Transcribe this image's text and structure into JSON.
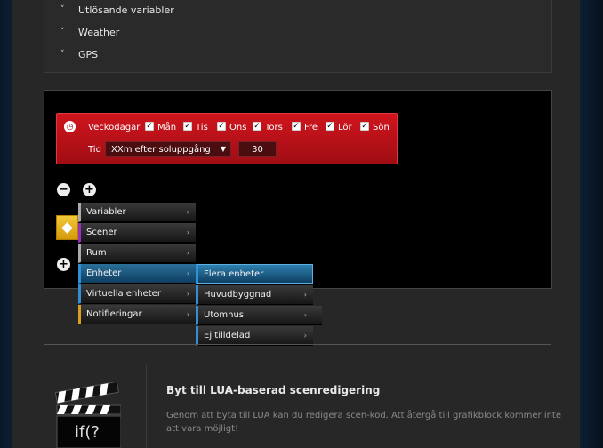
{
  "collapse_list": {
    "items": [
      {
        "label": "Utlösande variabler"
      },
      {
        "label": "Weather"
      },
      {
        "label": "GPS"
      }
    ]
  },
  "trigger": {
    "weekdays_label": "Veckodagar",
    "days": [
      "Mån",
      "Tis",
      "Ons",
      "Tors",
      "Fre",
      "Lör",
      "Sön"
    ],
    "time_label": "Tid",
    "time_select": "XXm efter soluppgång",
    "offset_value": "30"
  },
  "menu": {
    "items": [
      {
        "label": "Variabler",
        "accent": "#aaaaaa"
      },
      {
        "label": "Scener",
        "accent": "#9b30c0"
      },
      {
        "label": "Rum",
        "accent": "#aaaaaa"
      },
      {
        "label": "Enheter",
        "accent": "#2f8fd8"
      },
      {
        "label": "Virtuella enheter",
        "accent": "#2f8fd8"
      },
      {
        "label": "Notifieringar",
        "accent": "#d8a020"
      }
    ],
    "submenu": [
      {
        "label": "Flera enheter"
      },
      {
        "label": "Huvudbyggnad"
      },
      {
        "label": "Utomhus"
      },
      {
        "label": "Ej tilldelad"
      }
    ]
  },
  "lua": {
    "title": "Byt till LUA-baserad scenredigering",
    "description": "Genom att byta till LUA kan du redigera scen-kod. Att återgå till grafikblock kommer inte att vara möjligt!",
    "icon_text": "if(?"
  },
  "colors": {
    "trigger_red": "#c4121a",
    "menu_highlight": "#1f6ea0",
    "yellow_block": "#e8b020"
  }
}
